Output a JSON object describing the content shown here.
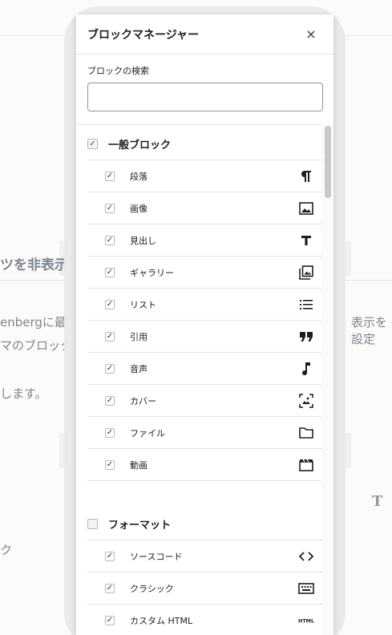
{
  "background": {
    "heading": "ツを非表示に",
    "line1_left": "enbergに最初",
    "line1_right": "表示を設定",
    "line2": "マのブロック",
    "line3": "します。",
    "line4": "ク",
    "glyph": "T"
  },
  "modal": {
    "title": "ブロックマネージャー",
    "close_label": "×",
    "search": {
      "label": "ブロックの検索",
      "value": "",
      "placeholder": ""
    }
  },
  "categories": [
    {
      "title": "一般ブロック",
      "checked": true,
      "blocks": [
        {
          "label": "段落",
          "icon": "paragraph-icon",
          "checked": true
        },
        {
          "label": "画像",
          "icon": "image-icon",
          "checked": true
        },
        {
          "label": "見出し",
          "icon": "heading-icon",
          "checked": true
        },
        {
          "label": "ギャラリー",
          "icon": "gallery-icon",
          "checked": true
        },
        {
          "label": "リスト",
          "icon": "list-icon",
          "checked": true
        },
        {
          "label": "引用",
          "icon": "quote-icon",
          "checked": true
        },
        {
          "label": "音声",
          "icon": "audio-icon",
          "checked": true
        },
        {
          "label": "カバー",
          "icon": "cover-icon",
          "checked": true
        },
        {
          "label": "ファイル",
          "icon": "file-icon",
          "checked": true
        },
        {
          "label": "動画",
          "icon": "video-icon",
          "checked": true
        }
      ]
    },
    {
      "title": "フォーマット",
      "checked": false,
      "blocks": [
        {
          "label": "ソースコード",
          "icon": "code-icon",
          "checked": true
        },
        {
          "label": "クラシック",
          "icon": "classic-icon",
          "checked": true
        },
        {
          "label": "カスタム HTML",
          "icon": "html-icon",
          "checked": true
        }
      ]
    }
  ]
}
